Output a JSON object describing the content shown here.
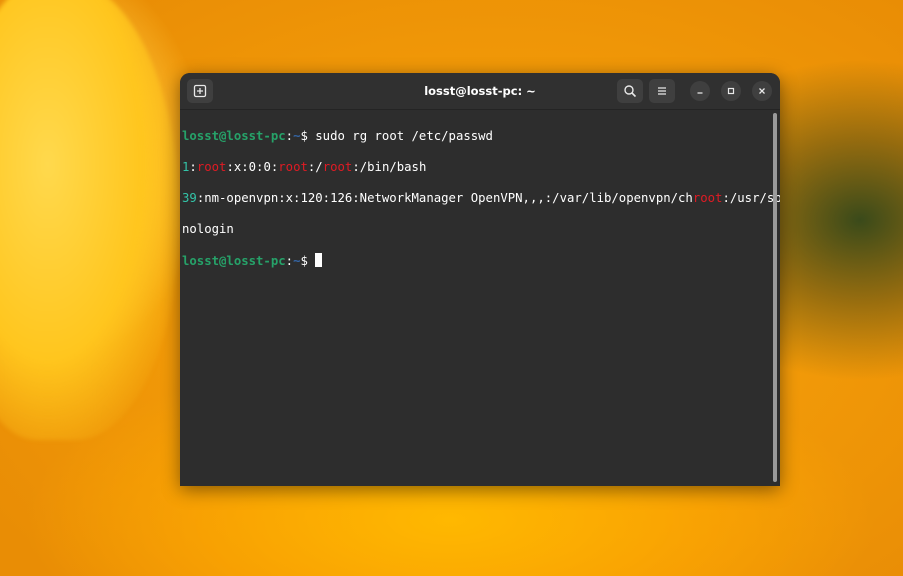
{
  "window": {
    "title": "losst@losst-pc: ~"
  },
  "icons": {
    "new_tab": "new-tab-icon",
    "search": "search-icon",
    "menu": "hamburger-menu-icon",
    "minimize": "minimize-icon",
    "maximize": "maximize-icon",
    "close": "close-icon"
  },
  "terminal": {
    "prompt_user": "losst@losst-pc",
    "prompt_sep": ":",
    "prompt_path": "~",
    "prompt_symbol": "$ ",
    "command": "sudo rg root /etc/passwd",
    "result1": {
      "num": "1",
      "parts": [
        ":",
        "root",
        ":x:0:0:",
        "root",
        ":/",
        "root",
        ":/bin/bash"
      ]
    },
    "result2": {
      "num": "39",
      "pre": ":nm-openvpn:x:120:126:NetworkManager OpenVPN,,,:/var/lib/openvpn/ch",
      "match": "root",
      "post": ":/usr/sbin/",
      "wrap": "nologin"
    }
  },
  "colors": {
    "prompt_user": "#26a269",
    "prompt_path": "#3465a4",
    "match": "#e01b24",
    "line_number": "#33c4a8",
    "terminal_bg": "#2d2d2d"
  }
}
